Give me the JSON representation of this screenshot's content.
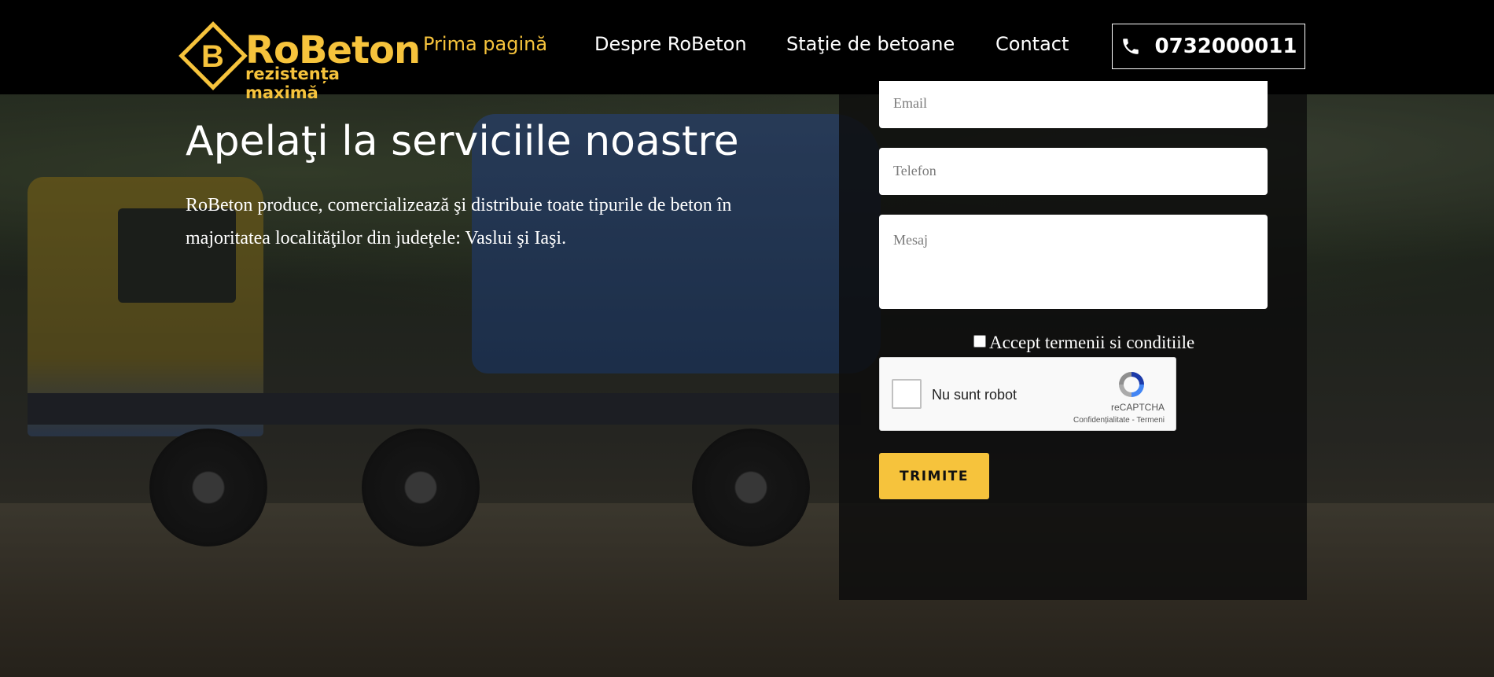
{
  "header": {
    "logo_letter": "B",
    "logo_name": "RoBeton",
    "logo_tagline": "rezistența maximă",
    "nav": [
      {
        "label": "Prima pagină",
        "active": true
      },
      {
        "label": "Despre RoBeton",
        "active": false
      },
      {
        "label": "Staţie de betoane",
        "active": false
      },
      {
        "label": "Contact",
        "active": false
      }
    ],
    "phone": "0732000011",
    "phone_icon": "phone-icon"
  },
  "hero": {
    "title": "Apelaţi la serviciile noastre",
    "text": "RoBeton produce, comercializează şi distribuie toate tipurile de beton în majoritatea localităţilor din judeţele: Vaslui şi Iaşi."
  },
  "form": {
    "email_placeholder": "Email",
    "phone_placeholder": "Telefon",
    "message_placeholder": "Mesaj",
    "accept_label": "Accept termenii si conditiile",
    "captcha_label": "Nu sunt robot",
    "captcha_brand": "reCAPTCHA",
    "captcha_links": "Confidențialitate - Termeni",
    "submit_label": "TRIMITE"
  },
  "colors": {
    "accent": "#f6c33c",
    "header_bg": "#000000",
    "panel_bg": "#0c0c0c"
  }
}
